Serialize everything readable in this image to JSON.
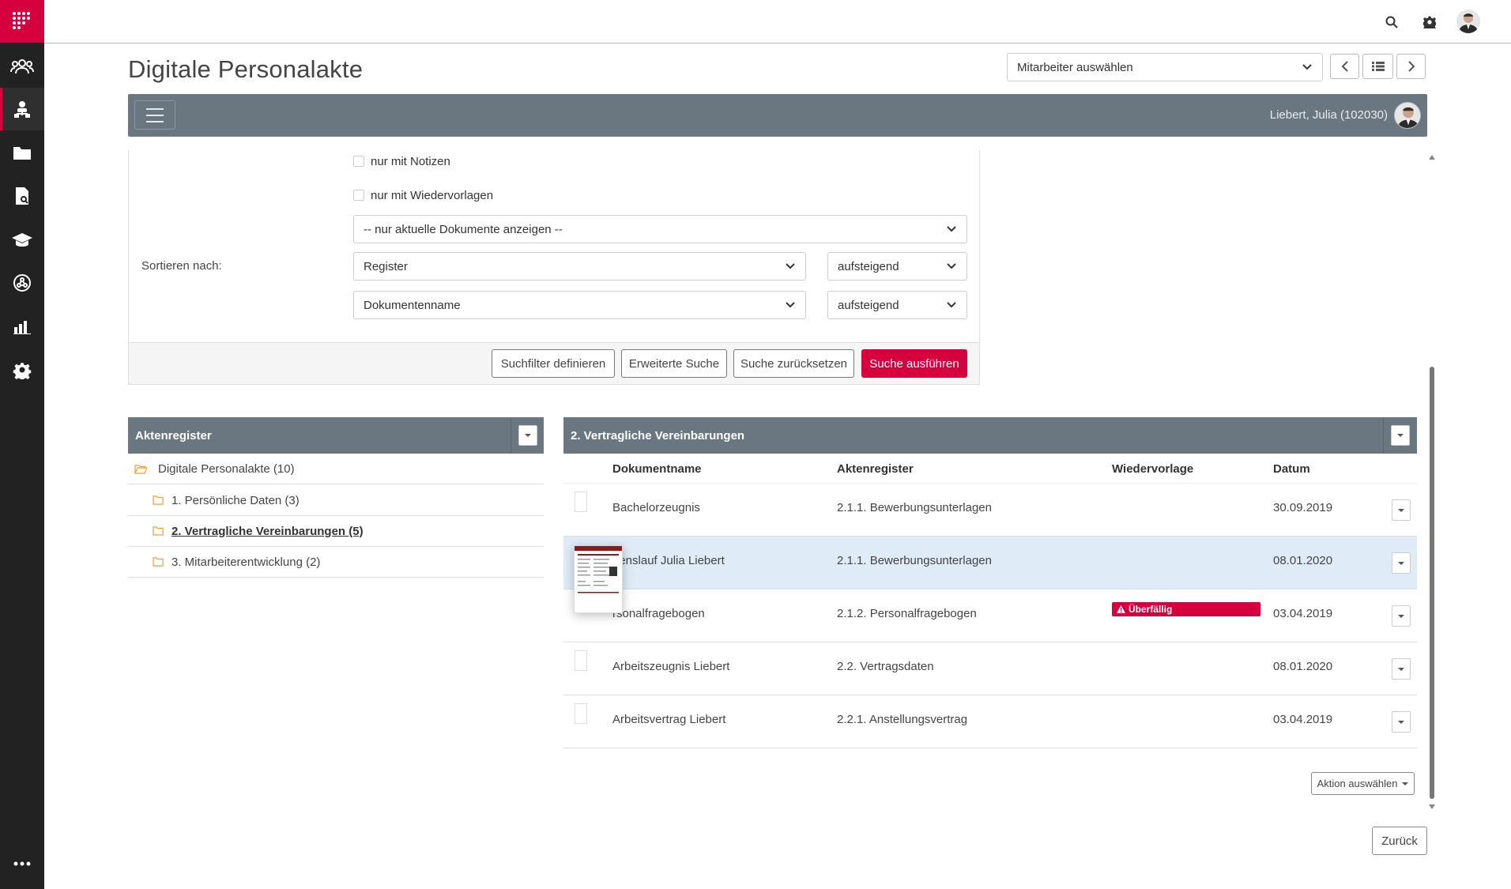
{
  "app": {
    "title": "Digitale Personalakte"
  },
  "header": {
    "employee_select": "Mitarbeiter auswählen",
    "user_label": "Liebert, Julia (102030)"
  },
  "icons": {
    "logo": "grid-dots-logo",
    "search": "search-icon",
    "settings": "gear-icon",
    "avatar": "avatar"
  },
  "sidebar": {
    "items": [
      {
        "name": "users-icon"
      },
      {
        "name": "person-tree-icon"
      },
      {
        "name": "folder-icon"
      },
      {
        "name": "document-search-icon"
      },
      {
        "name": "graduation-cap-icon"
      },
      {
        "name": "network-icon"
      },
      {
        "name": "bar-chart-icon"
      },
      {
        "name": "gear-icon"
      }
    ],
    "more": "more-icon"
  },
  "filters": {
    "only_notes": "nur mit Notizen",
    "only_resubmissions": "nur mit Wiedervorlagen",
    "doc_filter": "-- nur aktuelle Dokumente anzeigen --",
    "sort_label": "Sortieren nach:",
    "sort1": {
      "field": "Register",
      "order": "aufsteigend"
    },
    "sort2": {
      "field": "Dokumentenname",
      "order": "aufsteigend"
    },
    "buttons": {
      "define": "Suchfilter definieren",
      "advanced": "Erweiterte Suche",
      "reset": "Suche zurücksetzen",
      "run": "Suche ausführen"
    }
  },
  "tree": {
    "title": "Aktenregister",
    "root": "Digitale Personalakte (10)",
    "items": [
      "1. Persönliche Daten (3)",
      "2. Vertragliche Vereinbarungen (5)",
      "3. Mitarbeiterentwicklung (2)"
    ]
  },
  "docs": {
    "title": "2. Vertragliche Vereinbarungen",
    "columns": [
      "Dokumentname",
      "Aktenregister",
      "Wiedervorlage",
      "Datum"
    ],
    "rows": [
      {
        "name": "Bachelorzeugnis",
        "register": "2.1.1. Bewerbungsunterlagen",
        "resub": "",
        "date": "30.09.2019"
      },
      {
        "name": "benslauf Julia Liebert",
        "register": "2.1.1. Bewerbungsunterlagen",
        "resub": "",
        "date": "08.01.2020"
      },
      {
        "name": "rsonalfragebogen",
        "register": "2.1.2. Personalfragebogen",
        "resub": "Überfällig",
        "date": "03.04.2019"
      },
      {
        "name": "Arbeitszeugnis Liebert",
        "register": "2.2. Vertragsdaten",
        "resub": "",
        "date": "08.01.2020"
      },
      {
        "name": "Arbeitsvertrag Liebert",
        "register": "2.2.1. Anstellungsvertrag",
        "resub": "",
        "date": "03.04.2019"
      }
    ],
    "action": "Aktion auswählen"
  },
  "back": "Zurück",
  "colors": {
    "accent": "#d6003f",
    "bar": "#6b7780",
    "rail": "#222222",
    "selected_row": "#dfebf7"
  }
}
